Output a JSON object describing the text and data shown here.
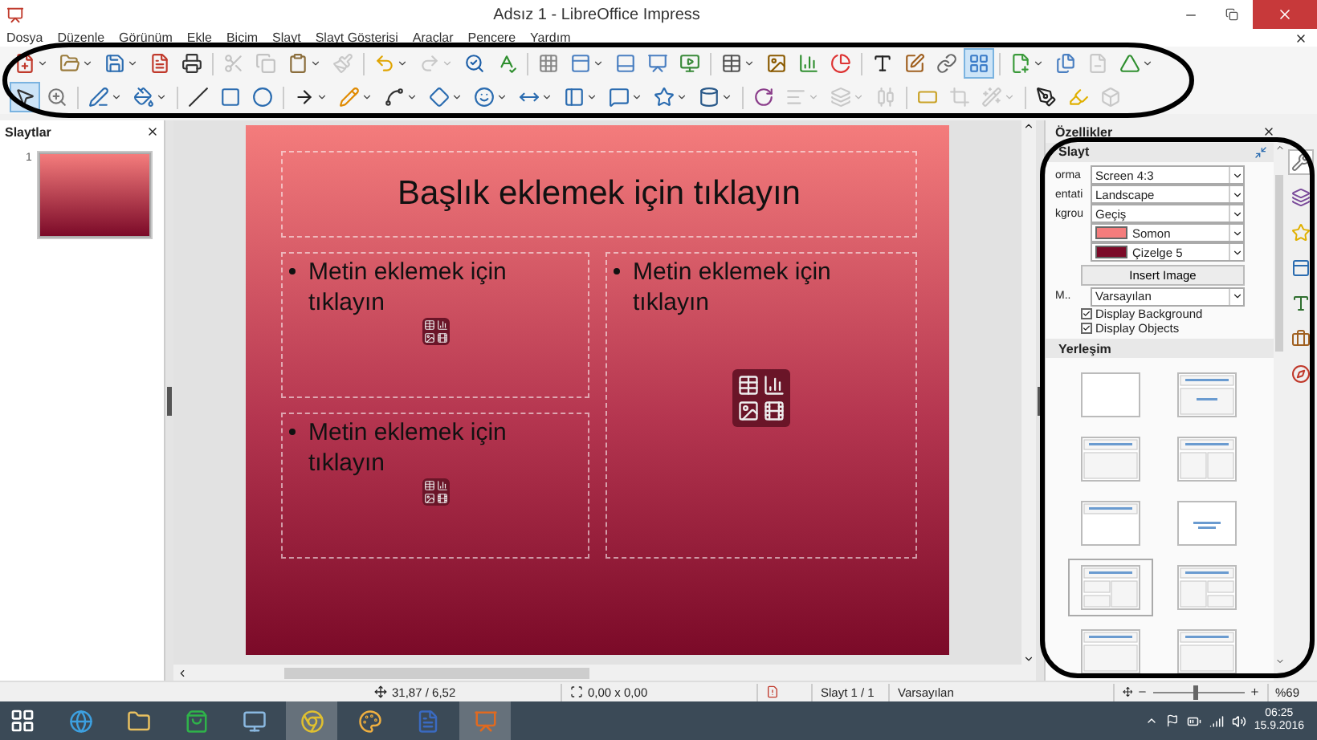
{
  "window": {
    "title": "Adsız 1 - LibreOffice Impress"
  },
  "menu": [
    "Dosya",
    "Düzenle",
    "Görünüm",
    "Ekle",
    "Biçim",
    "Slayt",
    "Slayt Gösterisi",
    "Araçlar",
    "Pencere",
    "Yardım"
  ],
  "toolbars": [
    [
      {
        "disabled": false,
        "selected": false,
        "dropdown": true
      },
      {
        "disabled": false,
        "selected": false,
        "dropdown": true
      },
      {
        "disabled": false,
        "selected": false,
        "dropdown": true
      },
      {
        "disabled": false,
        "selected": false,
        "dropdown": false
      },
      {
        "disabled": false,
        "selected": false,
        "dropdown": false
      },
      {
        "disabled": true,
        "selected": false,
        "dropdown": false
      },
      {
        "disabled": true,
        "selected": false,
        "dropdown": false
      },
      {
        "disabled": false,
        "selected": false,
        "dropdown": true
      },
      {
        "disabled": true,
        "selected": false,
        "dropdown": false
      },
      {
        "disabled": false,
        "selected": false,
        "dropdown": true
      },
      {
        "disabled": true,
        "selected": false,
        "dropdown": true
      },
      {
        "disabled": false,
        "selected": false,
        "dropdown": false
      },
      {
        "disabled": false,
        "selected": false,
        "dropdown": false
      },
      {
        "disabled": false,
        "selected": false,
        "dropdown": false
      },
      {
        "disabled": false,
        "selected": false,
        "dropdown": true
      },
      {
        "disabled": false,
        "selected": false,
        "dropdown": false
      },
      {
        "disabled": false,
        "selected": false,
        "dropdown": false
      },
      {
        "disabled": false,
        "selected": false,
        "dropdown": false
      },
      {
        "disabled": false,
        "selected": false,
        "dropdown": true
      },
      {
        "disabled": false,
        "selected": false,
        "dropdown": false
      },
      {
        "disabled": false,
        "selected": false,
        "dropdown": false
      },
      {
        "disabled": false,
        "selected": false,
        "dropdown": false
      },
      {
        "disabled": false,
        "selected": false,
        "dropdown": false
      },
      {
        "disabled": false,
        "selected": false,
        "dropdown": false
      },
      {
        "disabled": false,
        "selected": false,
        "dropdown": false
      },
      {
        "disabled": false,
        "selected": true,
        "dropdown": false
      },
      {
        "disabled": false,
        "selected": false,
        "dropdown": true
      },
      {
        "disabled": false,
        "selected": false,
        "dropdown": false
      },
      {
        "disabled": true,
        "selected": false,
        "dropdown": false
      },
      {
        "disabled": false,
        "selected": false,
        "dropdown": true
      }
    ],
    [
      {
        "disabled": false,
        "selected": true,
        "dropdown": false
      },
      {
        "disabled": false,
        "selected": false,
        "dropdown": false
      },
      {
        "disabled": false,
        "selected": false,
        "dropdown": true
      },
      {
        "disabled": false,
        "selected": false,
        "dropdown": true
      },
      {
        "disabled": false,
        "selected": false,
        "dropdown": false
      },
      {
        "disabled": false,
        "selected": false,
        "dropdown": false
      },
      {
        "disabled": false,
        "selected": false,
        "dropdown": false
      },
      {
        "disabled": false,
        "selected": false,
        "dropdown": true
      },
      {
        "disabled": false,
        "selected": false,
        "dropdown": true
      },
      {
        "disabled": false,
        "selected": false,
        "dropdown": true
      },
      {
        "disabled": false,
        "selected": false,
        "dropdown": true
      },
      {
        "disabled": false,
        "selected": false,
        "dropdown": true
      },
      {
        "disabled": false,
        "selected": false,
        "dropdown": true
      },
      {
        "disabled": false,
        "selected": false,
        "dropdown": true
      },
      {
        "disabled": false,
        "selected": false,
        "dropdown": true
      },
      {
        "disabled": false,
        "selected": false,
        "dropdown": true
      },
      {
        "disabled": false,
        "selected": false,
        "dropdown": true
      },
      {
        "disabled": false,
        "selected": false,
        "dropdown": false
      },
      {
        "disabled": true,
        "selected": false,
        "dropdown": true
      },
      {
        "disabled": true,
        "selected": false,
        "dropdown": true
      },
      {
        "disabled": true,
        "selected": false,
        "dropdown": false
      },
      {
        "disabled": false,
        "selected": false,
        "dropdown": false
      },
      {
        "disabled": true,
        "selected": false,
        "dropdown": false
      },
      {
        "disabled": true,
        "selected": false,
        "dropdown": true
      },
      {
        "disabled": false,
        "selected": false,
        "dropdown": false
      },
      {
        "disabled": false,
        "selected": false,
        "dropdown": false
      },
      {
        "disabled": true,
        "selected": false,
        "dropdown": false
      }
    ]
  ],
  "slides_panel": {
    "title": "Slaytlar",
    "slides": [
      {
        "number": "1",
        "selected": true
      }
    ]
  },
  "slide": {
    "title": "Başlık eklemek için tıklayın",
    "placeholders": [
      "Metin eklemek için tıklayın",
      "Metin eklemek için tıklayın",
      "Metin eklemek için tıklayın"
    ]
  },
  "sidebar": {
    "title": "Özellikler",
    "panel": "Slayt",
    "fields": [
      {
        "label": "orma",
        "value": "Screen 4:3"
      },
      {
        "label": "entati",
        "value": "Landscape"
      },
      {
        "label": "kgrou",
        "value": "Geçiş"
      },
      {
        "value": "Somon",
        "color": "#f47c7c"
      },
      {
        "value": "Çizelge 5",
        "color": "#7b0a28"
      }
    ],
    "insert_button": "Insert Image",
    "master": {
      "label": "M..",
      "value": "Varsayılan"
    },
    "checks": [
      {
        "label": "Display Background",
        "checked": true
      },
      {
        "label": "Display Objects",
        "checked": true
      }
    ],
    "layout_title": "Yerleşim",
    "layouts": [
      {
        "kind": "blank",
        "selected": false
      },
      {
        "kind": "title-subtitle",
        "selected": false
      },
      {
        "kind": "title-content",
        "selected": false
      },
      {
        "kind": "title-two-content",
        "selected": false
      },
      {
        "kind": "title-only",
        "selected": false
      },
      {
        "kind": "centered",
        "selected": false
      },
      {
        "kind": "title-two-left",
        "selected": true
      },
      {
        "kind": "title-two-right",
        "selected": false
      },
      {
        "kind": "title-content",
        "selected": false
      },
      {
        "kind": "title-content",
        "selected": false
      }
    ],
    "deck_tabs": [
      {
        "selected": true
      },
      {
        "selected": false
      },
      {
        "selected": false
      },
      {
        "selected": false
      },
      {
        "selected": false
      },
      {
        "selected": false
      },
      {
        "selected": false
      }
    ]
  },
  "status_bar": {
    "position": "31,87 / 6,52",
    "size": "0,00 x 0,00",
    "slide": "Slayt 1 / 1",
    "master": "Varsayılan",
    "zoom": {
      "level": 0.45
    },
    "zoom_text": "%69"
  },
  "taskbar": {
    "apps": [
      {
        "selected": false
      },
      {
        "selected": false
      },
      {
        "selected": false
      },
      {
        "selected": false
      },
      {
        "selected": true
      },
      {
        "selected": false
      },
      {
        "selected": false
      },
      {
        "selected": true
      }
    ],
    "time": "06:25",
    "date": "15.9.2016"
  }
}
